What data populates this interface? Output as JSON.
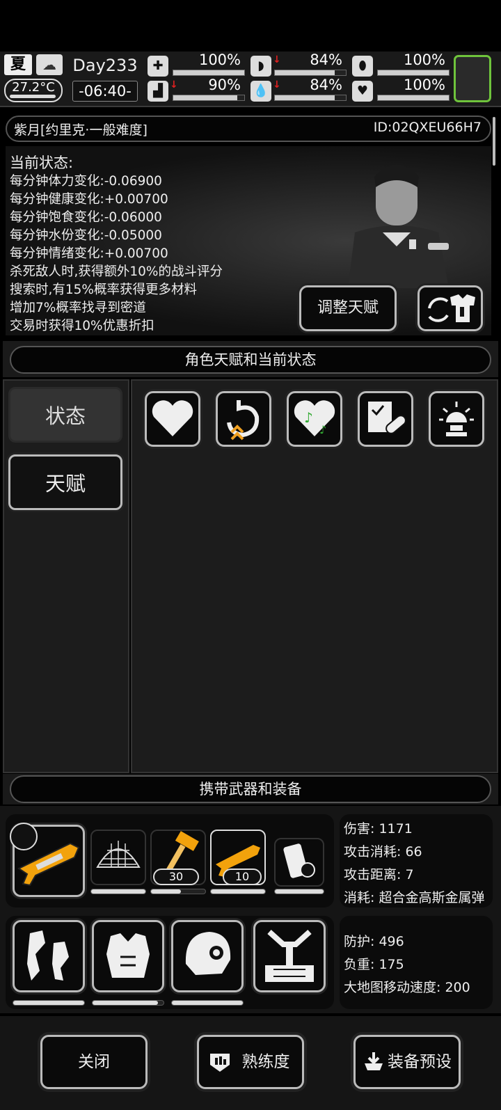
{
  "top": {
    "season": "夏",
    "temperature": "27.2°C",
    "day": "Day233",
    "clock": "-06:40-",
    "stats": [
      {
        "name": "health",
        "value": "100%",
        "level": 1.0,
        "down": false
      },
      {
        "name": "hunger",
        "value": "84%",
        "level": 0.84,
        "down": true
      },
      {
        "name": "pill",
        "value": "100%",
        "level": 1.0,
        "down": false
      },
      {
        "name": "stamina",
        "value": "90%",
        "level": 0.9,
        "down": true
      },
      {
        "name": "water",
        "value": "84%",
        "level": 0.84,
        "down": true
      },
      {
        "name": "mood",
        "value": "100%",
        "level": 1.0,
        "down": false
      }
    ]
  },
  "header": {
    "name": "紫月[约里克·一般难度]",
    "id": "ID:02QXEU66H7"
  },
  "status": {
    "title": "当前状态:",
    "lines": [
      "每分钟体力变化:-0.06900",
      "每分钟健康变化:+0.00700",
      "每分钟饱食变化:-0.06000",
      "每分钟水份变化:-0.05000",
      "每分钟情绪变化:+0.00700",
      "杀死敌人时,获得额外10%的战斗评分",
      "搜索时,有15%概率获得更多材料",
      "增加7%概率找寻到密道",
      "交易时获得10%优惠折扣"
    ],
    "adjust_talent": "调整天赋"
  },
  "section1": "角色天赋和当前状态",
  "tabs": {
    "status": "状态",
    "talent": "天赋"
  },
  "section2": "携带武器和装备",
  "weapons": {
    "badges": [
      "30",
      "10"
    ],
    "bars": [
      1.0,
      0.55,
      1.0,
      1.0
    ],
    "info": [
      "伤害: 1171",
      "攻击消耗: 66",
      "攻击距离: 7",
      "消耗: 超合金高斯金属弹"
    ]
  },
  "armor": {
    "bars": [
      1.0,
      0.92,
      1.0
    ],
    "info": [
      "防护: 496",
      "负重: 175",
      "大地图移动速度: 200"
    ]
  },
  "footer": {
    "close": "关闭",
    "proficiency": "熟练度",
    "preset": "装备预设"
  }
}
